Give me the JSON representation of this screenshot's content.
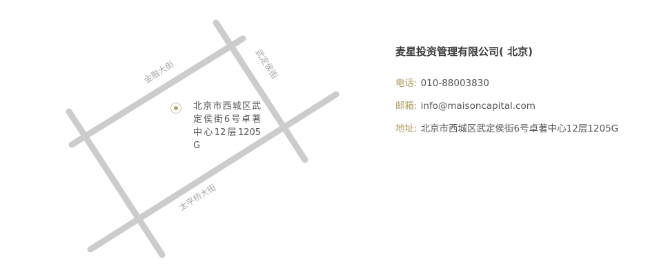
{
  "map": {
    "streets": [
      {
        "name": "金融大街"
      },
      {
        "name": "武定侯街"
      },
      {
        "name": "太平桥大街"
      }
    ],
    "address": "北京市西城区武定侯街6号卓著中心12层1205G",
    "colors": {
      "road": "#cccccc",
      "label": "#a8a8a8",
      "pin": "#b5a36a"
    },
    "icon": "location-pin-icon"
  },
  "info": {
    "company": "麦星投资管理有限公司( 北京)",
    "phone": {
      "label": "电话:",
      "value": "010-88003830"
    },
    "email": {
      "label": "邮箱:",
      "value": "info@maisoncapital.com"
    },
    "address": {
      "label": "地址:",
      "value": "北京市西城区武定侯街6号卓著中心12层1205G"
    },
    "colors": {
      "label": "#b09a5c",
      "text": "#555555",
      "title": "#3a3a3a"
    }
  }
}
